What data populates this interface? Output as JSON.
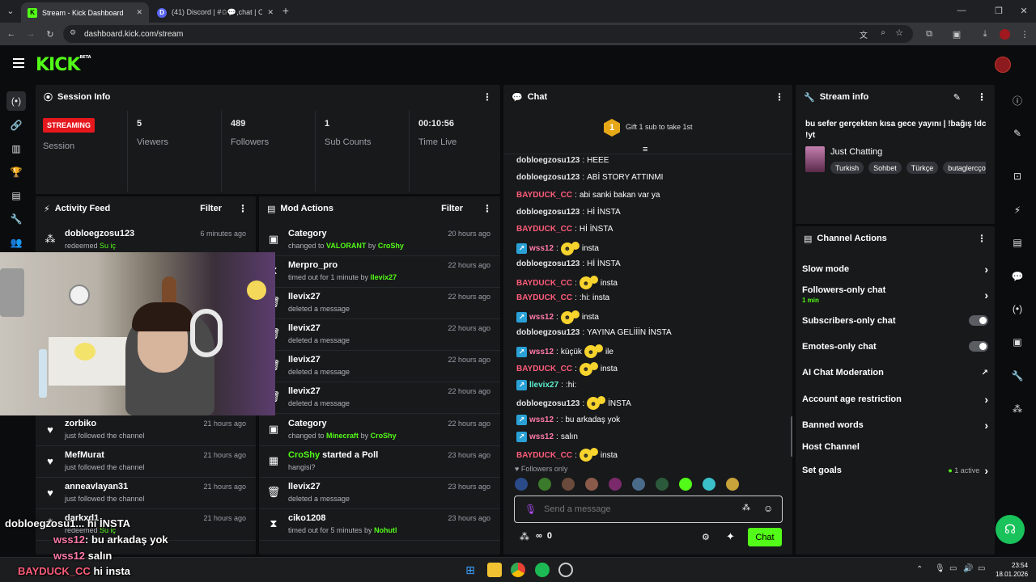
{
  "browser": {
    "tabs": [
      {
        "title": "Stream - Kick Dashboard",
        "favicon": "K"
      },
      {
        "title": "(41) Discord | #✩💬,chat | CroSh",
        "favicon": "D"
      }
    ],
    "url": "dashboard.kick.com/stream"
  },
  "kick": {
    "logo": "KICK",
    "beta": "BETA"
  },
  "session": {
    "title": "Session Info",
    "status_badge": "STREAMING",
    "status_label": "Session",
    "stats": [
      {
        "value": "5",
        "label": "Viewers"
      },
      {
        "value": "489",
        "label": "Followers"
      },
      {
        "value": "1",
        "label": "Sub Counts"
      },
      {
        "value": "00:10:56",
        "label": "Time Live"
      }
    ]
  },
  "activity": {
    "title": "Activity Feed",
    "filter": "Filter",
    "items": [
      {
        "user": "dobloegzosu123",
        "action": "redeemed",
        "extra": "Su iç",
        "time": "6 minutes ago"
      },
      {
        "user": "zorbiko",
        "action": "just followed the channel",
        "extra": "",
        "time": "21 hours ago"
      },
      {
        "user": "MefMurat",
        "action": "just followed the channel",
        "extra": "",
        "time": "21 hours ago"
      },
      {
        "user": "anneavlayan31",
        "action": "just followed the channel",
        "extra": "",
        "time": "21 hours ago"
      },
      {
        "user": "darkxd1",
        "action": "redeemed",
        "extra": "Su iç",
        "time": "21 hours ago"
      }
    ]
  },
  "mod": {
    "title": "Mod Actions",
    "filter": "Filter",
    "items": [
      {
        "title": "Category",
        "pre": "changed to ",
        "hl": "VALORANT",
        "mid": " by ",
        "by": "CroShy",
        "time": "20 hours ago"
      },
      {
        "title": "Merpro_pro",
        "pre": "timed out for 1 minute by ",
        "hl": "",
        "mid": "",
        "by": "llevix27",
        "time": "22 hours ago"
      },
      {
        "title": "llevix27",
        "pre": "deleted a message",
        "hl": "",
        "mid": "",
        "by": "",
        "time": "22 hours ago"
      },
      {
        "title": "llevix27",
        "pre": "deleted a message",
        "hl": "",
        "mid": "",
        "by": "",
        "time": "22 hours ago"
      },
      {
        "title": "llevix27",
        "pre": "deleted a message",
        "hl": "",
        "mid": "",
        "by": "",
        "time": "22 hours ago"
      },
      {
        "title": "llevix27",
        "pre": "deleted a message",
        "hl": "",
        "mid": "",
        "by": "",
        "time": "22 hours ago"
      },
      {
        "title": "Category",
        "pre": "changed to ",
        "hl": "Minecraft",
        "mid": " by ",
        "by": "CroShy",
        "time": "22 hours ago"
      },
      {
        "title_hl": "CroShy",
        "title": " started a Poll",
        "pre": "hangisi?",
        "hl": "",
        "mid": "",
        "by": "",
        "time": "23 hours ago"
      },
      {
        "title": "llevix27",
        "pre": "deleted a message",
        "hl": "",
        "mid": "",
        "by": "",
        "time": "23 hours ago"
      },
      {
        "title": "ciko1208",
        "pre": "timed out for 5 minutes by ",
        "hl": "",
        "mid": "",
        "by": "Nohutl",
        "time": "23 hours ago"
      }
    ]
  },
  "chat": {
    "title": "Chat",
    "gift_rank": "1",
    "gift_text": "Gift 1 sub to take 1st",
    "messages": [
      {
        "user": "dobloegzosu123",
        "cls": "u-dob",
        "badge": false,
        "emote": false,
        "text": "HEEE"
      },
      {
        "user": "dobloegzosu123",
        "cls": "u-dob",
        "badge": false,
        "emote": false,
        "text": "ABİ STORY ATTINMI"
      },
      {
        "user": "BAYDUCK_CC",
        "cls": "u-bay",
        "badge": false,
        "emote": false,
        "text": "abi sanki bakan var ya"
      },
      {
        "user": "dobloegzosu123",
        "cls": "u-dob",
        "badge": false,
        "emote": false,
        "text": "Hİ İNSTA"
      },
      {
        "user": "BAYDUCK_CC",
        "cls": "u-bay",
        "badge": false,
        "emote": false,
        "text": "Hİ İNSTA"
      },
      {
        "user": "wss12",
        "cls": "u-wss",
        "badge": true,
        "emote": true,
        "text": "insta"
      },
      {
        "user": "dobloegzosu123",
        "cls": "u-dob",
        "badge": false,
        "emote": false,
        "text": "Hİ İNSTA"
      },
      {
        "user": "BAYDUCK_CC",
        "cls": "u-bay",
        "badge": false,
        "emote": true,
        "text": "insta"
      },
      {
        "user": "BAYDUCK_CC",
        "cls": "u-bay",
        "badge": false,
        "emote": false,
        "text": ":hi: insta"
      },
      {
        "user": "wss12",
        "cls": "u-wss",
        "badge": true,
        "emote": true,
        "text": "insta"
      },
      {
        "user": "dobloegzosu123",
        "cls": "u-dob",
        "badge": false,
        "emote": false,
        "text": "YAYINA GELİİİN İNSTA"
      },
      {
        "user": "wss12",
        "cls": "u-wss",
        "badge": true,
        "emote": true,
        "text_pre": "küçük",
        "text": "ile"
      },
      {
        "user": "BAYDUCK_CC",
        "cls": "u-bay",
        "badge": false,
        "emote": true,
        "text": "insta"
      },
      {
        "user": "llevix27",
        "cls": "u-lle",
        "badge": true,
        "emote": false,
        "text": ":hi:"
      },
      {
        "user": "dobloegzosu123",
        "cls": "u-dob",
        "badge": false,
        "emote": true,
        "text": "İNSTA"
      },
      {
        "user": "wss12",
        "cls": "u-wss",
        "badge": true,
        "emote": false,
        "text": ": bu arkadaş yok"
      },
      {
        "user": "wss12",
        "cls": "u-wss",
        "badge": true,
        "emote": false,
        "text": "salın"
      },
      {
        "user": "BAYDUCK_CC",
        "cls": "u-bay",
        "badge": false,
        "emote": true,
        "text": "insta"
      }
    ],
    "followers_only": "Followers only",
    "input_placeholder": "Send a message",
    "count": "0",
    "send_label": "Chat"
  },
  "stream_info": {
    "title": "Stream info",
    "stream_title": "bu sefer gerçekten kısa gece yayını | !bağış !dc !yt",
    "category": "Just Chatting",
    "tags": [
      "Turkish",
      "Sohbet",
      "Türkçe",
      "butaglercço"
    ]
  },
  "channel_actions": {
    "title": "Channel Actions",
    "slow_mode": "Slow mode",
    "followers_only": "Followers-only chat",
    "followers_only_sub": "1 min",
    "subscribers_only": "Subscribers-only chat",
    "emotes_only": "Emotes-only chat",
    "ai_moderation": "AI Chat Moderation",
    "account_age": "Account age restriction",
    "banned_words": "Banned words",
    "host_channel": "Host Channel",
    "set_goals": "Set goals",
    "goals_status": "1 active"
  },
  "overlay": {
    "lines": [
      {
        "user": "dobloegzosu1...",
        "text": "hi İNSTA"
      },
      {
        "user": "wss12",
        "text": ": bu arkadaş yok"
      },
      {
        "user": "wss12",
        "text": "salın"
      },
      {
        "user": "BAYDUCK_CC",
        "text": "hi insta"
      }
    ]
  },
  "taskbar": {
    "time": "23:54",
    "date": "18.01.2026"
  },
  "colors": {
    "kick_green": "#53fc18",
    "streaming_red": "#e5181e",
    "panel": "#18191b"
  }
}
